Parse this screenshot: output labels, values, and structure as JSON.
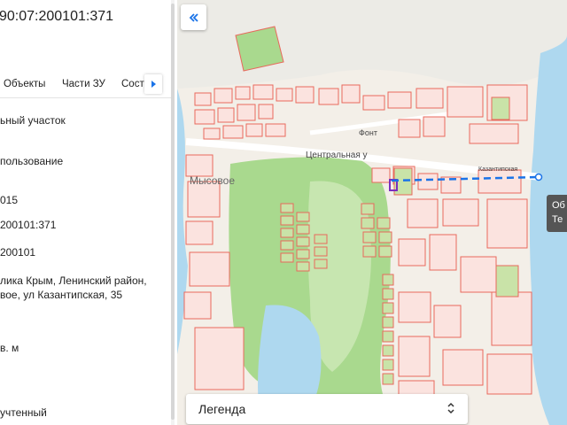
{
  "panel": {
    "cadastral_number": "90:07:200101:371",
    "tabs": [
      "Объекты",
      "Части ЗУ",
      "Соста"
    ],
    "fields": [
      "ьный участок",
      "пользование",
      "015",
      "200101:371",
      "200101",
      "лика Крым, Ленинский район,",
      "вое, ул Казантипская, 35",
      "в. м",
      "учтенный"
    ]
  },
  "map": {
    "place_label": "Мысовое",
    "street_central": "Центральная у",
    "street_minor": "Фонт",
    "street_kazantip": "Казантипская",
    "tooltip_lines": [
      "Об",
      "Те"
    ],
    "legend_title": "Легенда"
  },
  "colors": {
    "parcel_stroke": "#e8695c",
    "parcel_fill": "#fbe3df",
    "forest": "#a9d98e",
    "water": "#aed8ef",
    "selected": "#7b2fbe",
    "measure_line": "#1a73e8"
  }
}
